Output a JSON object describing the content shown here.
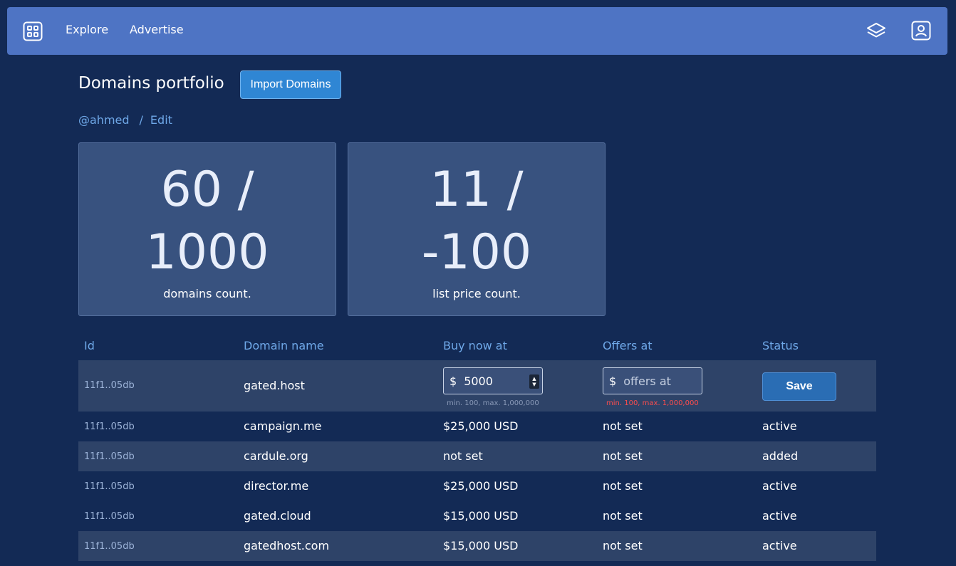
{
  "nav": {
    "explore": "Explore",
    "advertise": "Advertise",
    "logo_icon": "grid-apps-icon",
    "layers_icon": "layers-icon",
    "profile_icon": "profile-badge-icon"
  },
  "header": {
    "title": "Domains portfolio",
    "import_label": "Import Domains"
  },
  "breadcrumb": {
    "user": "@ahmed",
    "separator": "/",
    "current": "Edit"
  },
  "stats": [
    {
      "value": "60 /\n1000",
      "label": "domains count."
    },
    {
      "value": "11 /\n-100",
      "label": "list price count."
    }
  ],
  "table": {
    "headers": [
      "Id",
      "Domain name",
      "Buy now at",
      "Offers at",
      "Status"
    ],
    "edit_row": {
      "id": "11f1..05db",
      "name": "gated.host",
      "currency": "$",
      "buy_value": "5000",
      "offer_placeholder": "offers at",
      "buy_hint": "min. 100, max. 1,000,000",
      "offer_hint": "min. 100, max. 1,000,000",
      "save_label": "Save"
    },
    "rows": [
      {
        "id": "11f1..05db",
        "name": "campaign.me",
        "buy": "$25,000 USD",
        "offer": "not set",
        "status": "active"
      },
      {
        "id": "11f1..05db",
        "name": "cardule.org",
        "buy": "not set",
        "offer": "not set",
        "status": "added"
      },
      {
        "id": "11f1..05db",
        "name": "director.me",
        "buy": "$25,000 USD",
        "offer": "not set",
        "status": "active"
      },
      {
        "id": "11f1..05db",
        "name": "gated.cloud",
        "buy": "$15,000 USD",
        "offer": "not set",
        "status": "active"
      },
      {
        "id": "11f1..05db",
        "name": "gatedhost.com",
        "buy": "$15,000 USD",
        "offer": "not set",
        "status": "active"
      }
    ]
  },
  "colors": {
    "background": "#132a55",
    "navbar": "#4e74c4",
    "accent": "#2f86d4",
    "error": "#ff4d4d"
  }
}
